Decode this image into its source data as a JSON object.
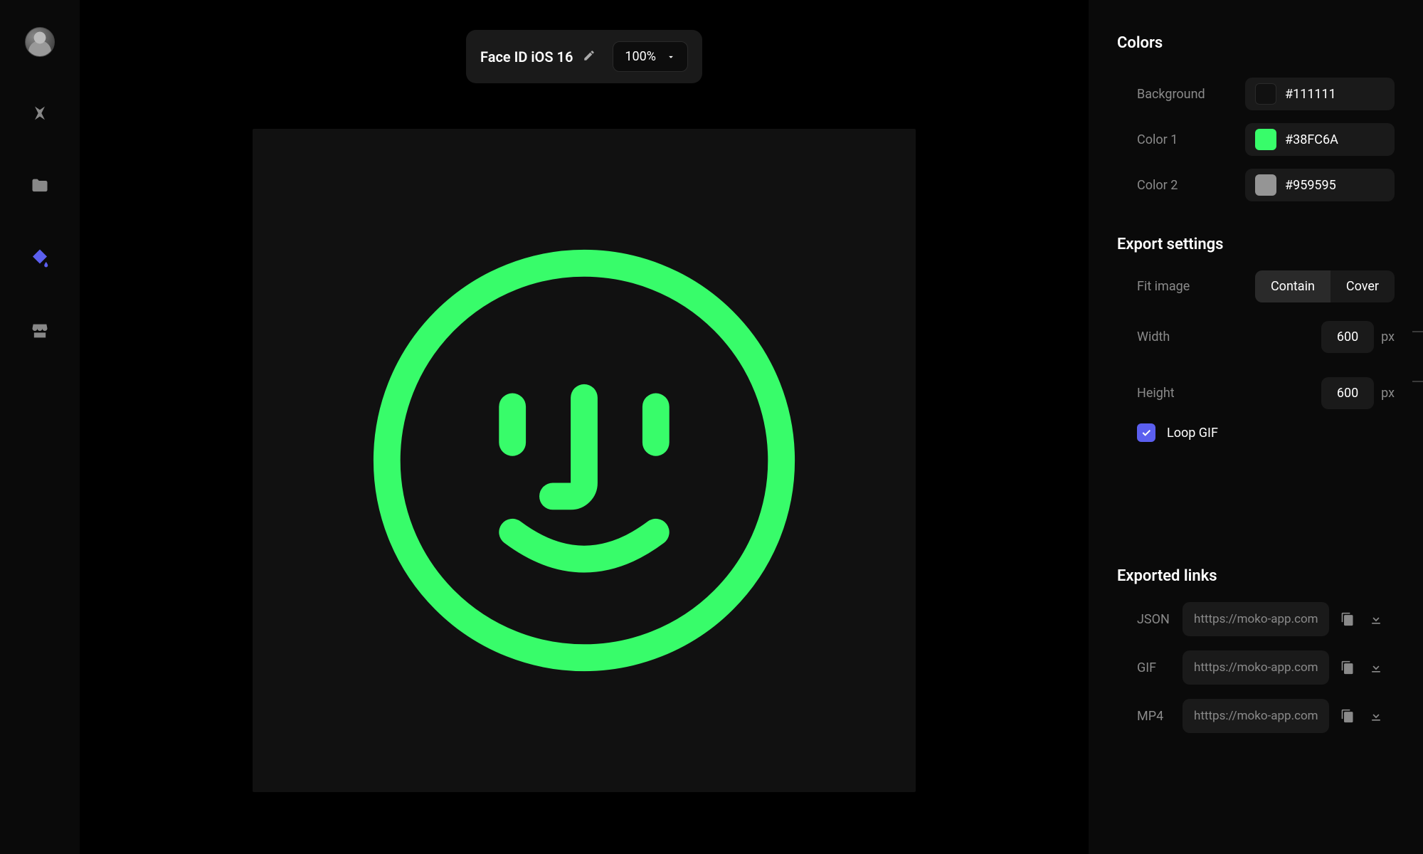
{
  "sidebar": {
    "nav": [
      {
        "name": "logo-icon"
      },
      {
        "name": "folder-icon"
      },
      {
        "name": "paint-bucket-icon",
        "active": true
      },
      {
        "name": "store-icon"
      }
    ]
  },
  "toolbar": {
    "title": "Face ID iOS 16",
    "zoom": "100%"
  },
  "canvas": {
    "bg": "#111111",
    "face_color": "#38FC6A"
  },
  "panel": {
    "colors_title": "Colors",
    "colors": [
      {
        "label": "Background",
        "hex": "#111111",
        "swatch": "#111111"
      },
      {
        "label": "Color 1",
        "hex": "#38FC6A",
        "swatch": "#38FC6A"
      },
      {
        "label": "Color 2",
        "hex": "#959595",
        "swatch": "#959595"
      }
    ],
    "export_title": "Export settings",
    "fit_label": "Fit image",
    "fit_options": {
      "contain": "Contain",
      "cover": "Cover"
    },
    "width_label": "Width",
    "width_value": "600",
    "height_label": "Height",
    "height_value": "600",
    "unit": "px",
    "loop_label": "Loop GIF",
    "loop_checked": true,
    "links_title": "Exported links",
    "links": [
      {
        "label": "JSON",
        "url": "htttps://moko-app.com"
      },
      {
        "label": "GIF",
        "url": "htttps://moko-app.com"
      },
      {
        "label": "MP4",
        "url": "htttps://moko-app.com"
      }
    ]
  }
}
